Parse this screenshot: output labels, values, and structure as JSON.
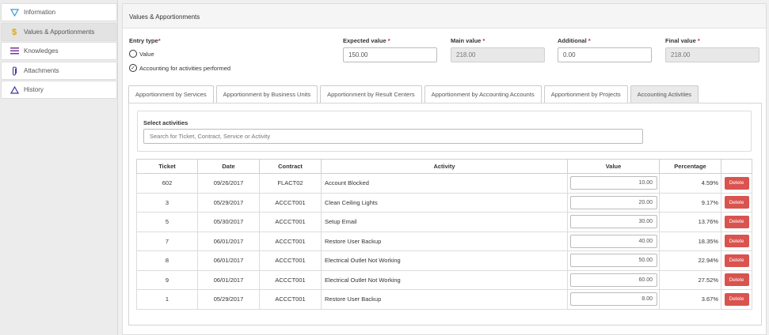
{
  "sidebar": {
    "items": [
      {
        "label": "Information",
        "icon": "funnel-icon",
        "color": "#3a9ad9"
      },
      {
        "label": "Values & Apportionments",
        "icon": "dollar-icon",
        "color": "#e0a800"
      },
      {
        "label": "Knowledges",
        "icon": "list-icon",
        "color": "#7b3fa0"
      },
      {
        "label": "Attachments",
        "icon": "paperclip-icon",
        "color": "#3b3b9e"
      },
      {
        "label": "History",
        "icon": "triangle-icon",
        "color": "#3b3b9e"
      }
    ]
  },
  "panel": {
    "title": "Values & Apportionments"
  },
  "form": {
    "entry_type_label": "Entry type",
    "required_mark": "*",
    "option_value": "Value",
    "option_accounting": "Accounting for activities performed",
    "expected_label": "Expected value",
    "expected_value": "150.00",
    "main_label": "Main value",
    "main_value": "218.00",
    "additional_label": "Additional",
    "additional_value": "0.00",
    "final_label": "Final value",
    "final_value": "218.00"
  },
  "tabs": [
    "Apportionment by Services",
    "Apportionment by Business Units",
    "Apportionment by Result Centers",
    "Apportionment by Accounting Accounts",
    "Apportionment by Projects",
    "Accounting Activities"
  ],
  "activities": {
    "select_label": "Select activities",
    "search_placeholder": "Search for Ticket, Contract, Service or Activity",
    "columns": [
      "Ticket",
      "Date",
      "Contract",
      "Activity",
      "Value",
      "Percentage",
      ""
    ],
    "delete_label": "Delete",
    "rows": [
      {
        "ticket": "602",
        "date": "09/26/2017",
        "contract": "FLACT02",
        "activity": "Account Blocked",
        "value": "10.00",
        "percentage": "4.59%"
      },
      {
        "ticket": "3",
        "date": "05/29/2017",
        "contract": "ACCCT001",
        "activity": "Clean Ceiling Lights",
        "value": "20.00",
        "percentage": "9.17%"
      },
      {
        "ticket": "5",
        "date": "05/30/2017",
        "contract": "ACCCT001",
        "activity": "Setup Email",
        "value": "30.00",
        "percentage": "13.76%"
      },
      {
        "ticket": "7",
        "date": "06/01/2017",
        "contract": "ACCCT001",
        "activity": "Restore User Backup",
        "value": "40.00",
        "percentage": "18.35%"
      },
      {
        "ticket": "8",
        "date": "06/01/2017",
        "contract": "ACCCT001",
        "activity": "Electrical Outlet Not Working",
        "value": "50.00",
        "percentage": "22.94%"
      },
      {
        "ticket": "9",
        "date": "06/01/2017",
        "contract": "ACCCT001",
        "activity": "Electrical Outlet Not Working",
        "value": "60.00",
        "percentage": "27.52%"
      },
      {
        "ticket": "1",
        "date": "05/29/2017",
        "contract": "ACCCT001",
        "activity": "Restore User Backup",
        "value": "8.00",
        "percentage": "3.67%"
      }
    ]
  },
  "colors": {
    "delete": "#d9534f",
    "required": "#c9302c"
  }
}
